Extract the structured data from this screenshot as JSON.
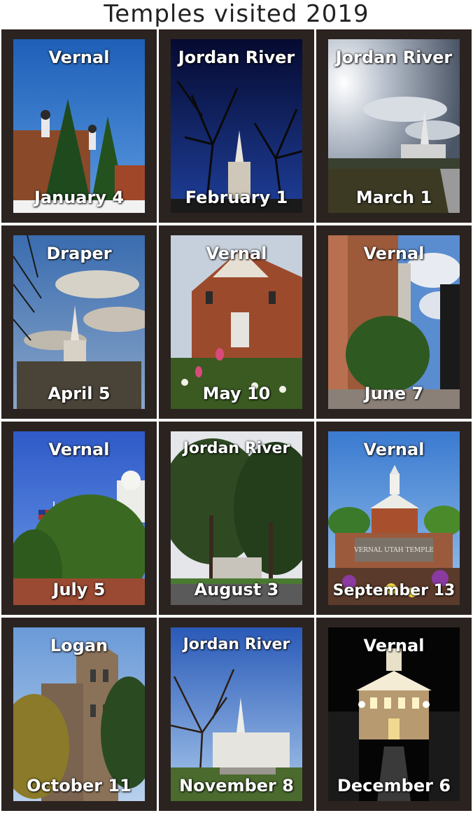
{
  "title": "Temples visited 2019",
  "cells": [
    {
      "place": "Vernal",
      "date": "January 4"
    },
    {
      "place": "Jordan River",
      "date": "February 1"
    },
    {
      "place": "Jordan River",
      "date": "March 1"
    },
    {
      "place": "Draper",
      "date": "April 5"
    },
    {
      "place": "Vernal",
      "date": "May 10"
    },
    {
      "place": "Vernal",
      "date": "June 7"
    },
    {
      "place": "Vernal",
      "date": "July 5"
    },
    {
      "place": "Jordan River",
      "date": "August 3"
    },
    {
      "place": "Vernal",
      "date": "September 13"
    },
    {
      "place": "Logan",
      "date": "October 11"
    },
    {
      "place": "Jordan River",
      "date": "November 8"
    },
    {
      "place": "Vernal",
      "date": "December 6"
    }
  ],
  "sign_text": "VERNAL UTAH TEMPLE"
}
